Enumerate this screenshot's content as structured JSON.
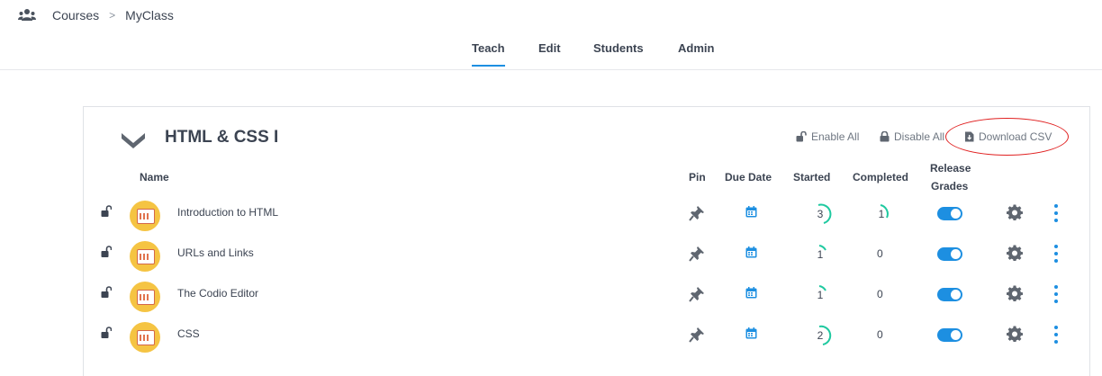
{
  "breadcrumb": {
    "icon": "users-icon",
    "items": [
      "Courses",
      "MyClass"
    ],
    "separator": ">"
  },
  "tabs": [
    {
      "label": "Teach",
      "active": true
    },
    {
      "label": "Edit",
      "active": false
    },
    {
      "label": "Students",
      "active": false
    },
    {
      "label": "Admin",
      "active": false
    }
  ],
  "unit": {
    "title": "HTML & CSS I",
    "actions": {
      "enable_all": "Enable All",
      "disable_all": "Disable All",
      "download_csv": "Download CSV"
    }
  },
  "table": {
    "headers": {
      "name": "Name",
      "pin": "Pin",
      "due_date": "Due Date",
      "started": "Started",
      "completed": "Completed",
      "release_grades_line1": "Release",
      "release_grades_line2": "Grades"
    },
    "rows": [
      {
        "name": "Introduction to HTML",
        "started": "3",
        "completed": "1",
        "release_grades": true
      },
      {
        "name": "URLs and Links",
        "started": "1",
        "completed": "0",
        "release_grades": true
      },
      {
        "name": "The Codio Editor",
        "started": "1",
        "completed": "0",
        "release_grades": true
      },
      {
        "name": "CSS",
        "started": "2",
        "completed": "0",
        "release_grades": true
      }
    ]
  },
  "colors": {
    "accent": "#1d8fe1",
    "progress_arc": "#1fc9a0",
    "annotation": "#e02020"
  }
}
